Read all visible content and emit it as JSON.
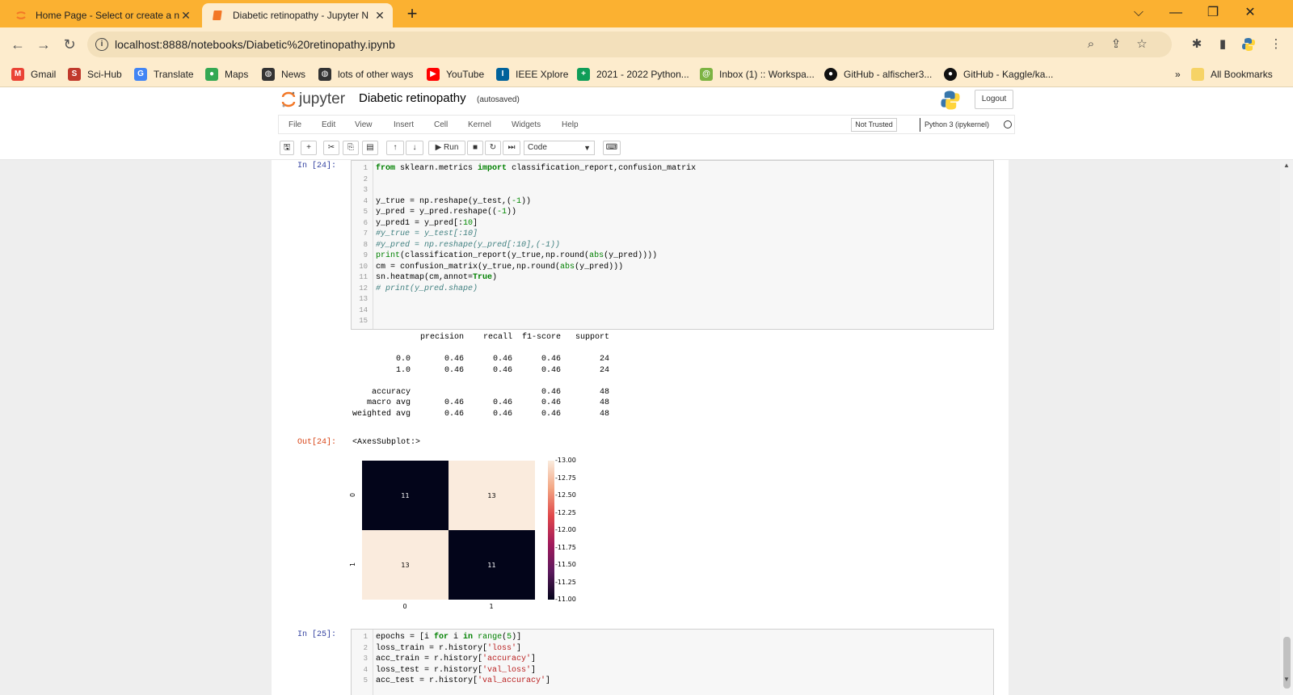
{
  "browser": {
    "tabs": [
      {
        "title": "Home Page - Select or create a n",
        "active": false
      },
      {
        "title": "Diabetic retinopathy - Jupyter N",
        "active": true
      }
    ],
    "url": "localhost:8888/notebooks/Diabetic%20retinopathy.ipynb",
    "bookmarks": [
      {
        "label": "Gmail",
        "icon": "gmail-icon",
        "color": "#ea4335"
      },
      {
        "label": "Sci-Hub",
        "icon": "scihub-icon",
        "color": "#c0392b"
      },
      {
        "label": "Translate",
        "icon": "translate-icon",
        "color": "#4285f4"
      },
      {
        "label": "Maps",
        "icon": "maps-icon",
        "color": "#34a853"
      },
      {
        "label": "News",
        "icon": "globe-icon",
        "color": "#333333"
      },
      {
        "label": "lots of other ways",
        "icon": "globe-icon",
        "color": "#333333"
      },
      {
        "label": "YouTube",
        "icon": "youtube-icon",
        "color": "#ff0000"
      },
      {
        "label": "IEEE Xplore",
        "icon": "ieee-icon",
        "color": "#00629b"
      },
      {
        "label": "2021 - 2022 Python...",
        "icon": "sheets-icon",
        "color": "#0f9d58"
      },
      {
        "label": "Inbox (1) :: Workspa...",
        "icon": "mail-icon",
        "color": "#7cb342"
      },
      {
        "label": "GitHub - alfischer3...",
        "icon": "github-icon",
        "color": "#111111"
      },
      {
        "label": "GitHub - Kaggle/ka...",
        "icon": "github-icon",
        "color": "#111111"
      }
    ],
    "all_bookmarks": "All Bookmarks",
    "more_bookmarks": "»"
  },
  "jupyter": {
    "logo_text": "jupyter",
    "notebook_name": "Diabetic retinopathy",
    "autosave_status": "(autosaved)",
    "logout_label": "Logout",
    "menus": [
      "File",
      "Edit",
      "View",
      "Insert",
      "Cell",
      "Kernel",
      "Widgets",
      "Help"
    ],
    "trust_status": "Not Trusted",
    "kernel_name": "Python 3 (ipykernel)",
    "run_label": "Run",
    "cell_type": "Code"
  },
  "cell24": {
    "prompt_in": "In [24]:",
    "prompt_out": "Out[24]:",
    "line_numbers": [
      "1",
      "2",
      "3",
      "4",
      "5",
      "6",
      "7",
      "8",
      "9",
      "10",
      "11",
      "12",
      "13",
      "14",
      "15"
    ],
    "out_repr": "<AxesSubplot:>",
    "report": [
      "              precision    recall  f1-score   support",
      "",
      "         0.0       0.46      0.46      0.46        24",
      "         1.0       0.46      0.46      0.46        24",
      "",
      "    accuracy                           0.46        48",
      "   macro avg       0.46      0.46      0.46        48",
      "weighted avg       0.46      0.46      0.46        48"
    ]
  },
  "cell25": {
    "prompt_in": "In [25]:",
    "line_numbers": [
      "1",
      "2",
      "3",
      "4",
      "5"
    ]
  },
  "chart_data": {
    "type": "heatmap",
    "matrix": [
      [
        11,
        13
      ],
      [
        13,
        11
      ]
    ],
    "x_tick_labels": [
      "0",
      "1"
    ],
    "y_tick_labels": [
      "0",
      "1"
    ],
    "colorbar_ticks": [
      "13.00",
      "12.75",
      "12.50",
      "12.25",
      "12.00",
      "11.75",
      "11.50",
      "11.25",
      "11.00"
    ],
    "vmin": 11,
    "vmax": 13,
    "colors": {
      "low": "#03051a",
      "high": "#faebdd"
    }
  }
}
